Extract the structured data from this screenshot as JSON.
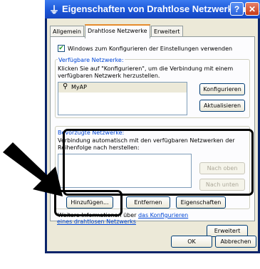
{
  "window": {
    "title": "Eigenschaften von Drahtlose Netzwerkverbi..."
  },
  "tabs": [
    "Allgemein",
    "Drahtlose Netzwerke",
    "Erweitert"
  ],
  "use_windows_label": "Windows zum Konfigurieren der Einstellungen verwenden",
  "available": {
    "label": "Verfügbare Netzwerke:",
    "desc1": "Klicken Sie auf \"Konfigurieren\", um die Verbindung mit einem",
    "desc2": "verfügbaren Netzwerk herzustellen.",
    "network": "MyAP",
    "configure": "Konfigurieren",
    "refresh": "Aktualisieren"
  },
  "preferred": {
    "label": "Bevorzugte Netzwerke:",
    "desc1": "Verbindung automatisch mit den verfügbaren Netzwerken der",
    "desc2": "Reihenfolge nach herstellen:",
    "up": "Nach oben",
    "down": "Nach unten",
    "add": "Hinzufügen...",
    "remove": "Entfernen",
    "properties": "Eigenschaften"
  },
  "info": {
    "line1_prefix": "Weitere Informationen über ",
    "link1": "das Konfigurieren",
    "link2": "eines drahtlosen Netzwerks"
  },
  "advanced": "Erweitert",
  "ok": "OK",
  "cancel": "Abbrechen",
  "colors": {
    "titlebar": "#1c57d8",
    "dialog": "#ece9d8",
    "highlight": "#000000"
  }
}
